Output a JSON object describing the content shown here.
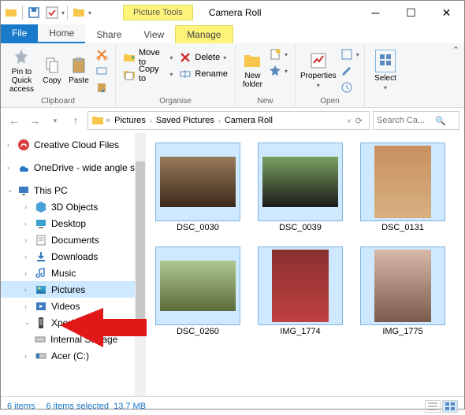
{
  "window": {
    "title": "Camera Roll",
    "picture_tools": "Picture Tools"
  },
  "tabs": {
    "file": "File",
    "home": "Home",
    "share": "Share",
    "view": "View",
    "manage": "Manage"
  },
  "ribbon": {
    "pin": "Pin to Quick access",
    "copy": "Copy",
    "paste": "Paste",
    "clipboard": "Clipboard",
    "moveto": "Move to",
    "copyto": "Copy to",
    "delete": "Delete",
    "rename": "Rename",
    "organise": "Organise",
    "newfolder": "New folder",
    "new": "New",
    "properties": "Properties",
    "open": "Open",
    "select": "Select"
  },
  "breadcrumb": {
    "a": "Pictures",
    "b": "Saved Pictures",
    "c": "Camera Roll"
  },
  "search": {
    "placeholder": "Search Ca..."
  },
  "tree": {
    "ccf": "Creative Cloud Files",
    "onedrive": "OneDrive - wide angle s",
    "thispc": "This PC",
    "obj3d": "3D Objects",
    "desktop": "Desktop",
    "documents": "Documents",
    "downloads": "Downloads",
    "music": "Music",
    "pictures": "Pictures",
    "videos": "Videos",
    "xperia": "Xperia Z3",
    "internal": "Internal Storage",
    "acer": "Acer (C:)"
  },
  "thumbs": [
    {
      "name": "DSC_0030"
    },
    {
      "name": "DSC_0039"
    },
    {
      "name": "DSC_0131"
    },
    {
      "name": "DSC_0260"
    },
    {
      "name": "IMG_1774"
    },
    {
      "name": "IMG_1775"
    }
  ],
  "status": {
    "items": "6 items",
    "selected": "6 items selected",
    "size": "13.7 MB"
  }
}
